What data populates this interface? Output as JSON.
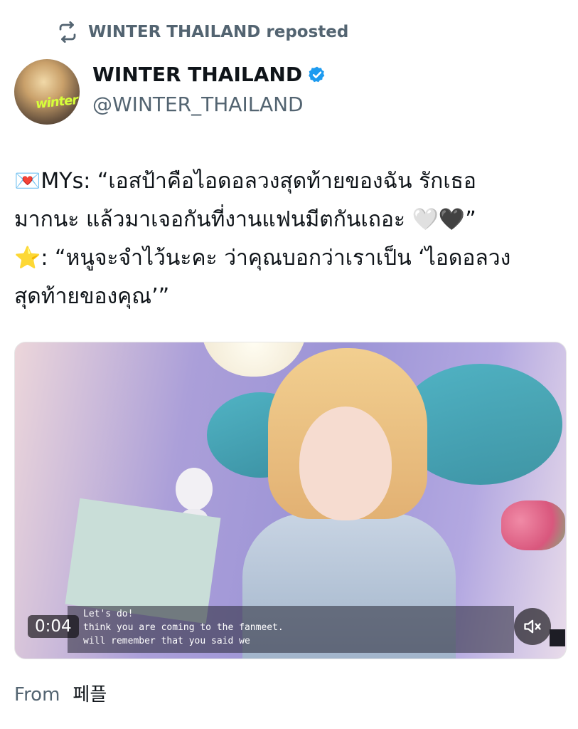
{
  "repost": {
    "icon": "repost-icon",
    "text": "WINTER THAILAND reposted"
  },
  "author": {
    "avatar_text": "winter",
    "name": "WINTER THAILAND",
    "verified_icon": "verified-badge-icon",
    "handle": "@WINTER_THAILAND"
  },
  "post": {
    "lines": [
      "💌MYs: “เอสป้าคือไอดอลวงสุดท้ายของฉัน รักเธอ",
      "มากนะ แล้วมาเจอกันที่งานแฟนมีตกันเถอะ 🤍🖤”",
      "⭐: “หนูจะจำไว้นะคะ ว่าคุณบอกว่าเราเป็น ‘ไอดอลวง",
      "สุดท้ายของคุณ’”"
    ]
  },
  "video": {
    "time": "0:04",
    "subtitles": [
      "Let's do!",
      "think you are coming to the fanmeet.",
      "will remember that you said we"
    ],
    "mute_icon": "muted-speaker-icon"
  },
  "source": {
    "label": "From",
    "name": "페플"
  },
  "colors": {
    "secondary_text": "#536471",
    "primary_text": "#0f1419",
    "verified": "#1d9bf0"
  }
}
